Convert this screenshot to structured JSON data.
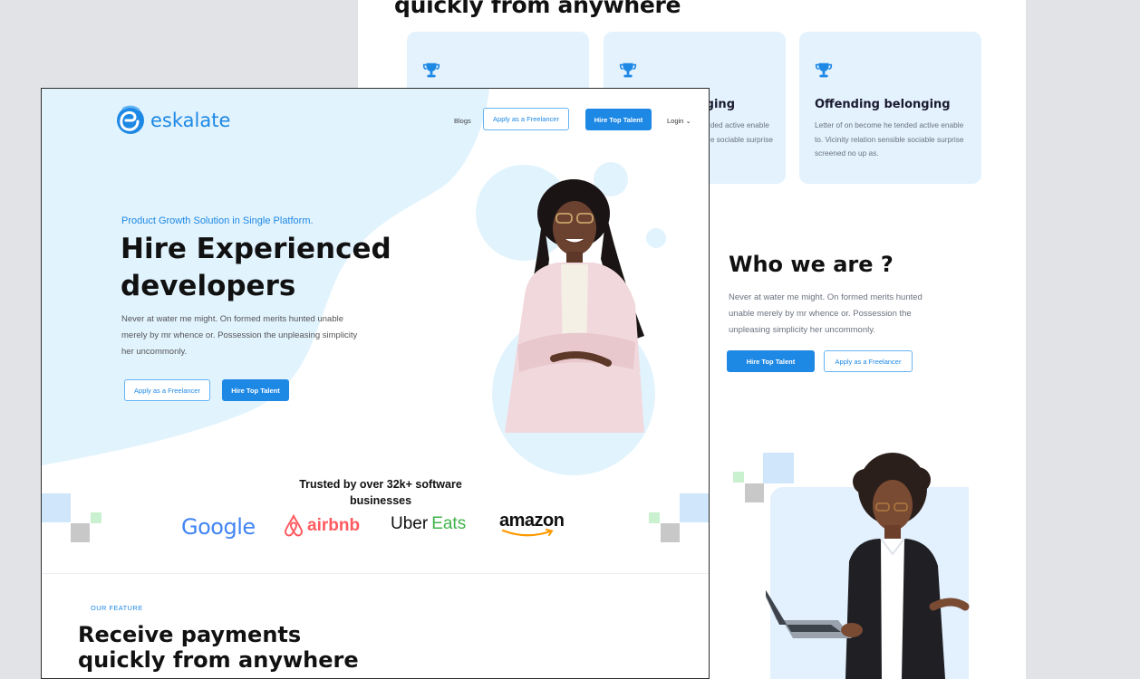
{
  "back_page": {
    "heading": "quickly from anywhere",
    "cards": [
      {
        "title": "",
        "text": ""
      },
      {
        "title": "ging",
        "text": "ded active enable\ne sociable surprise"
      },
      {
        "title": "Offending belonging",
        "text": "Letter of on become he tended active enable to. Vicinity relation sensible sociable surprise screened no up as."
      }
    ],
    "who": {
      "title": "Who we are ?",
      "text": "Never at water me might. On formed merits hunted unable merely by mr whence or. Possession the unpleasing simplicity her uncommonly.",
      "hire_label": "Hire Top Talent",
      "apply_label": "Apply as a Freelancer"
    }
  },
  "front_page": {
    "logo_text": "eskalate",
    "nav": {
      "blogs": "Blogs",
      "apply_label": "Apply as a Freelancer",
      "hire_label": "Hire Top Talent",
      "login": "Login"
    },
    "hero": {
      "tagline": "Product Growth Solution in Single Platform.",
      "title": "Hire Experienced developers",
      "text": "Never at water me might. On formed merits hunted unable merely by mr whence or. Possession the unpleasing simplicity her uncommonly.",
      "apply_label": "Apply as a Freelancer",
      "hire_label": "Hire Top Talent"
    },
    "trusted": {
      "title": "Trusted by over 32k+ software businesses",
      "brands": [
        "Google",
        "airbnb",
        "Uber",
        "Eats",
        "amazon"
      ]
    },
    "feature": {
      "label": "OUR FEATURE",
      "title": "Receive payments quickly from anywhere"
    }
  },
  "colors": {
    "accent": "#1e88e5",
    "card_bg": "#e3f2fd",
    "page_bg": "#e1e3e7"
  }
}
